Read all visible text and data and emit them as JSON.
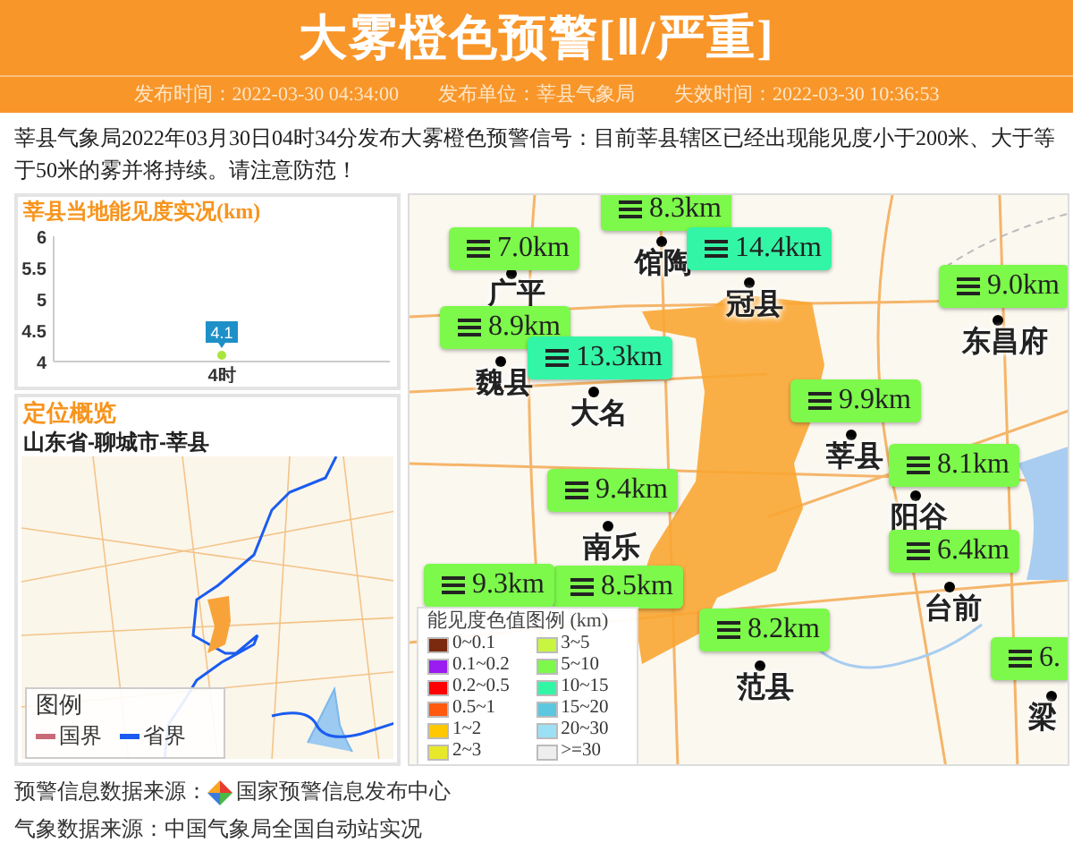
{
  "header": {
    "title": "大雾橙色预警[Ⅱ/严重]",
    "meta": [
      "发布时间：2022-03-30 04:34:00",
      "发布单位：莘县气象局",
      "失效时间：2022-03-30 10:36:53"
    ]
  },
  "description": "莘县气象局2022年03月30日04时34分发布大雾橙色预警信号：目前莘县辖区已经出现能见度小于200米、大于等于50米的雾并将持续。请注意防范！",
  "visibility_panel": {
    "title": "莘县当地能见度实况(km)",
    "chart_data": {
      "type": "line",
      "categories": [
        "4时"
      ],
      "series": [
        {
          "color": "#a8e63c",
          "marker": true,
          "values": [
            4.1
          ]
        }
      ],
      "ylim": [
        4,
        6
      ],
      "yticks": [
        4,
        4.5,
        5,
        5.5,
        6
      ],
      "data_labels": true
    }
  },
  "location_panel": {
    "title": "定位概览",
    "path": "山东省-聊城市-莘县",
    "legend": {
      "title": "图例",
      "items": [
        {
          "label": "国界",
          "color": "#c86a78"
        },
        {
          "label": "省界",
          "color": "#1a5cf0"
        }
      ]
    }
  },
  "map": {
    "stations": [
      {
        "value": "8.3km",
        "color": "#7cf94a"
      },
      {
        "value": "7.0km",
        "color": "#7cf94a"
      },
      {
        "value": "14.4km",
        "color": "#33f5a6"
      },
      {
        "value": "9.0km",
        "color": "#7cf94a"
      },
      {
        "value": "8.9km",
        "color": "#7cf94a"
      },
      {
        "value": "13.3km",
        "color": "#33f5a6"
      },
      {
        "value": "9.9km",
        "color": "#7cf94a"
      },
      {
        "value": "8.1km",
        "color": "#7cf94a"
      },
      {
        "value": "9.4km",
        "color": "#7cf94a"
      },
      {
        "value": "8.5km",
        "color": "#7cf94a"
      },
      {
        "value": "9.3km",
        "color": "#7cf94a"
      },
      {
        "value": "6.4km",
        "color": "#7cf94a"
      },
      {
        "value": "8.2km",
        "color": "#7cf94a"
      },
      {
        "value": "6.",
        "color": "#7cf94a"
      }
    ],
    "cities": [
      {
        "name": "馆陶"
      },
      {
        "name": "冠县"
      },
      {
        "name": "广平"
      },
      {
        "name": "东昌府"
      },
      {
        "name": "魏县"
      },
      {
        "name": "大名"
      },
      {
        "name": "莘县"
      },
      {
        "name": "阳谷"
      },
      {
        "name": "南乐"
      },
      {
        "name": "台前"
      },
      {
        "name": "范县"
      },
      {
        "name": "梁"
      }
    ],
    "legend": {
      "title": "能见度色值图例 (km)",
      "items": [
        {
          "label": "0~0.1",
          "color": "#7b2a10"
        },
        {
          "label": "0.1~0.2",
          "color": "#9a1cf0"
        },
        {
          "label": "0.2~0.5",
          "color": "#ff0000"
        },
        {
          "label": "0.5~1",
          "color": "#ff5a10"
        },
        {
          "label": "1~2",
          "color": "#ffc800"
        },
        {
          "label": "2~3",
          "color": "#e8e82a"
        },
        {
          "label": "3~5",
          "color": "#c8f540"
        },
        {
          "label": "5~10",
          "color": "#7cf94a"
        },
        {
          "label": "10~15",
          "color": "#33f5a6"
        },
        {
          "label": "15~20",
          "color": "#5cc8e0"
        },
        {
          "label": "20~30",
          "color": "#9ce0f5"
        },
        {
          "label": ">=30",
          "color": "#eeeeee"
        }
      ]
    }
  },
  "footer": {
    "alert_source": {
      "label": "预警信息数据来源：",
      "name": "国家预警信息发布中心"
    },
    "weather_source": "气象数据来源：中国气象局全国自动站实况"
  }
}
